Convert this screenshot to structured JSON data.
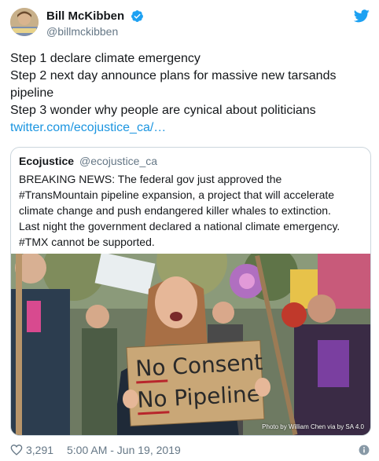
{
  "author": {
    "name": "Bill McKibben",
    "handle": "@billmckibben",
    "avatar_icon": "user-avatar"
  },
  "tweet": {
    "lines": [
      "Step 1 declare climate emergency",
      "Step 2 next day announce plans for massive new tarsands",
      "pipeline",
      "Step 3 wonder why people are cynical about politicians"
    ],
    "link": "twitter.com/ecojustice_ca/…"
  },
  "quoted": {
    "author": "Ecojustice",
    "handle": "@ecojustice_ca",
    "lines": [
      "BREAKING NEWS: The federal gov just approved the",
      "#TransMountain pipeline expansion, a project that will accelerate",
      "climate change and push endangered killer whales to extinction.",
      "Last night the government declared a national climate emergency.",
      "#TMX cannot be supported."
    ],
    "photo": {
      "sign_line1": "No Consent",
      "sign_line2": "No Pipeline",
      "credit": "Photo by William Chen via by SA 4.0"
    }
  },
  "footer": {
    "likes": "3,291",
    "timestamp": "5:00 AM - Jun 19, 2019"
  },
  "colors": {
    "link": "#1b95e0",
    "verified": "#1da1f2",
    "twitter_brand": "#1da1f2",
    "muted": "#657786"
  }
}
